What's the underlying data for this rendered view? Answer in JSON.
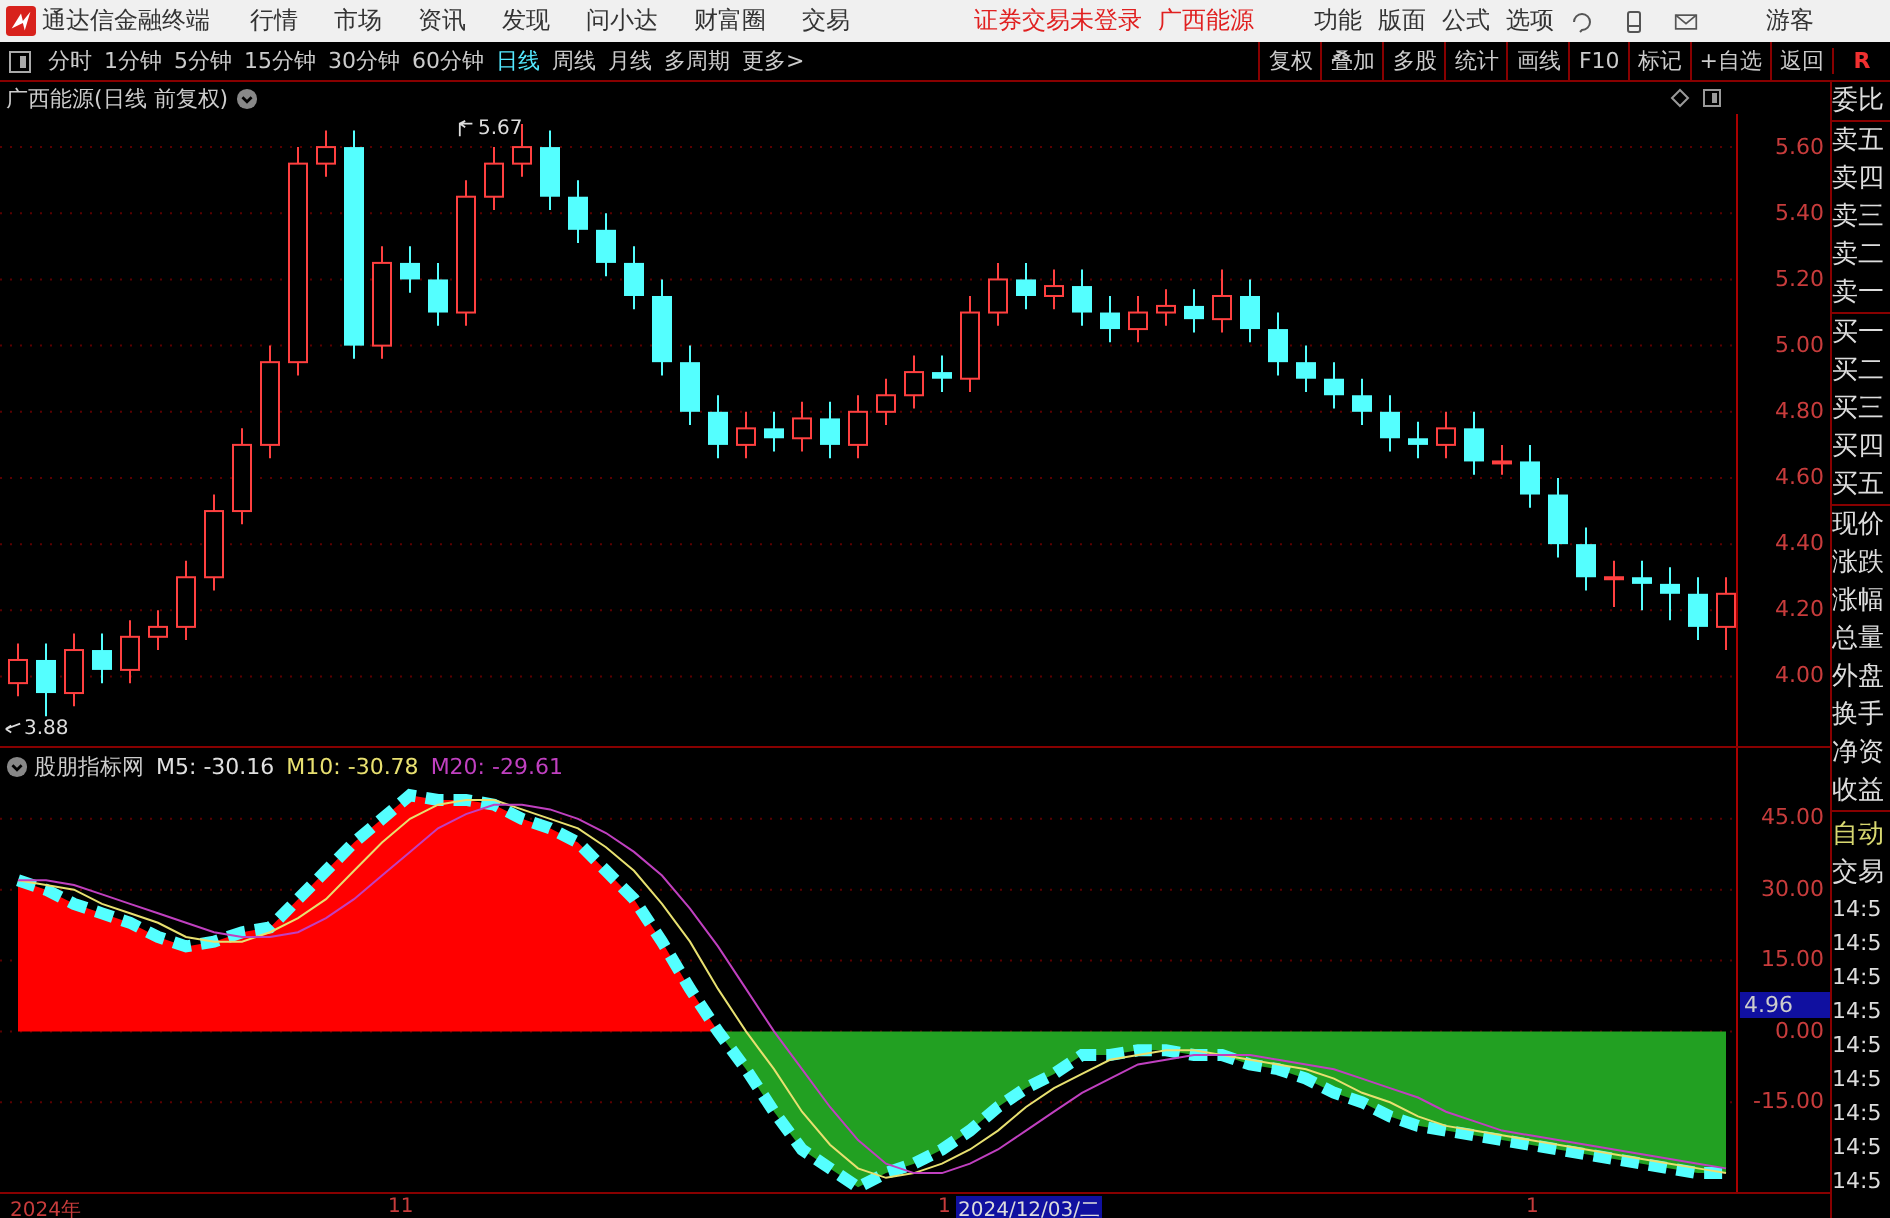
{
  "app_bar": {
    "app_name": "通达信金融终端",
    "menu": [
      "行情",
      "市场",
      "资讯",
      "发现",
      "问小达",
      "财富圈",
      "交易"
    ],
    "login_status": "证券交易未登录",
    "stock_name": "广西能源",
    "actions": [
      "功能",
      "版面",
      "公式",
      "选项"
    ],
    "user": "游客"
  },
  "period_tabs": [
    {
      "label": "分时",
      "selected": false
    },
    {
      "label": "1分钟",
      "selected": false
    },
    {
      "label": "5分钟",
      "selected": false
    },
    {
      "label": "15分钟",
      "selected": false
    },
    {
      "label": "30分钟",
      "selected": false
    },
    {
      "label": "60分钟",
      "selected": false
    },
    {
      "label": "日线",
      "selected": true
    },
    {
      "label": "周线",
      "selected": false
    },
    {
      "label": "月线",
      "selected": false
    },
    {
      "label": "多周期",
      "selected": false
    },
    {
      "label": "更多>",
      "selected": false
    }
  ],
  "chart_tools": [
    "复权",
    "叠加",
    "多股",
    "统计",
    "画线",
    "F10",
    "标记",
    "+自选",
    "返回"
  ],
  "right_column_header": "R",
  "price_chart": {
    "title": "广西能源(日线 前复权)",
    "high_marker": "5.67",
    "low_marker": "3.88",
    "chart_data": {
      "type": "candlestick",
      "grid": true,
      "ylim": [
        3.79,
        5.7
      ],
      "yticks": [
        {
          "value": 5.6,
          "label": "5.60"
        },
        {
          "value": 5.4,
          "label": "5.40"
        },
        {
          "value": 5.2,
          "label": "5.20"
        },
        {
          "value": 5.0,
          "label": "5.00"
        },
        {
          "value": 4.8,
          "label": "4.80"
        },
        {
          "value": 4.6,
          "label": "4.60"
        },
        {
          "value": 4.4,
          "label": "4.40"
        },
        {
          "value": 4.2,
          "label": "4.20"
        },
        {
          "value": 4.0,
          "label": "4.00"
        }
      ],
      "ohlc": [
        [
          3.98,
          4.1,
          3.94,
          4.05
        ],
        [
          4.05,
          4.1,
          3.88,
          3.95
        ],
        [
          3.95,
          4.13,
          3.91,
          4.08
        ],
        [
          4.08,
          4.13,
          3.98,
          4.02
        ],
        [
          4.02,
          4.17,
          3.98,
          4.12
        ],
        [
          4.12,
          4.2,
          4.08,
          4.15
        ],
        [
          4.15,
          4.35,
          4.11,
          4.3
        ],
        [
          4.3,
          4.55,
          4.26,
          4.5
        ],
        [
          4.5,
          4.75,
          4.46,
          4.7
        ],
        [
          4.7,
          5.0,
          4.66,
          4.95
        ],
        [
          4.95,
          5.6,
          4.91,
          5.55
        ],
        [
          5.55,
          5.65,
          5.51,
          5.6
        ],
        [
          5.6,
          5.65,
          4.96,
          5.0
        ],
        [
          5.0,
          5.3,
          4.96,
          5.25
        ],
        [
          5.25,
          5.3,
          5.16,
          5.2
        ],
        [
          5.2,
          5.25,
          5.06,
          5.1
        ],
        [
          5.1,
          5.5,
          5.06,
          5.45
        ],
        [
          5.45,
          5.6,
          5.41,
          5.55
        ],
        [
          5.55,
          5.67,
          5.51,
          5.6
        ],
        [
          5.6,
          5.65,
          5.41,
          5.45
        ],
        [
          5.45,
          5.5,
          5.31,
          5.35
        ],
        [
          5.35,
          5.4,
          5.21,
          5.25
        ],
        [
          5.25,
          5.3,
          5.11,
          5.15
        ],
        [
          5.15,
          5.2,
          4.91,
          4.95
        ],
        [
          4.95,
          5.0,
          4.76,
          4.8
        ],
        [
          4.8,
          4.85,
          4.66,
          4.7
        ],
        [
          4.7,
          4.8,
          4.66,
          4.75
        ],
        [
          4.75,
          4.8,
          4.68,
          4.72
        ],
        [
          4.72,
          4.83,
          4.68,
          4.78
        ],
        [
          4.78,
          4.83,
          4.66,
          4.7
        ],
        [
          4.7,
          4.85,
          4.66,
          4.8
        ],
        [
          4.8,
          4.9,
          4.76,
          4.85
        ],
        [
          4.85,
          4.97,
          4.81,
          4.92
        ],
        [
          4.92,
          4.97,
          4.86,
          4.9
        ],
        [
          4.9,
          5.15,
          4.86,
          5.1
        ],
        [
          5.1,
          5.25,
          5.06,
          5.2
        ],
        [
          5.2,
          5.25,
          5.11,
          5.15
        ],
        [
          5.15,
          5.23,
          5.11,
          5.18
        ],
        [
          5.18,
          5.23,
          5.06,
          5.1
        ],
        [
          5.1,
          5.15,
          5.01,
          5.05
        ],
        [
          5.05,
          5.15,
          5.01,
          5.1
        ],
        [
          5.1,
          5.17,
          5.06,
          5.12
        ],
        [
          5.12,
          5.17,
          5.04,
          5.08
        ],
        [
          5.08,
          5.23,
          5.04,
          5.15
        ],
        [
          5.15,
          5.2,
          5.01,
          5.05
        ],
        [
          5.05,
          5.1,
          4.91,
          4.95
        ],
        [
          4.95,
          5.0,
          4.86,
          4.9
        ],
        [
          4.9,
          4.95,
          4.81,
          4.85
        ],
        [
          4.85,
          4.9,
          4.76,
          4.8
        ],
        [
          4.8,
          4.85,
          4.68,
          4.72
        ],
        [
          4.72,
          4.77,
          4.66,
          4.7
        ],
        [
          4.7,
          4.8,
          4.66,
          4.75
        ],
        [
          4.75,
          4.8,
          4.61,
          4.65
        ],
        [
          4.65,
          4.7,
          4.61,
          4.65
        ],
        [
          4.65,
          4.7,
          4.51,
          4.55
        ],
        [
          4.55,
          4.6,
          4.36,
          4.4
        ],
        [
          4.4,
          4.45,
          4.26,
          4.3
        ],
        [
          4.3,
          4.35,
          4.21,
          4.3
        ],
        [
          4.3,
          4.35,
          4.2,
          4.28
        ],
        [
          4.28,
          4.33,
          4.17,
          4.25
        ],
        [
          4.25,
          4.3,
          4.11,
          4.15
        ],
        [
          4.15,
          4.3,
          4.08,
          4.25
        ]
      ]
    }
  },
  "indicator": {
    "name": "股朋指标网",
    "legend_values": [
      ": -30.16",
      ": -30.78",
      ": -29.61"
    ],
    "current_value": "4.96",
    "chart_data": {
      "type": "line",
      "grid": true,
      "ylim": [
        -34,
        60
      ],
      "yticks": [
        {
          "value": 45,
          "label": "45.00"
        },
        {
          "value": 30,
          "label": "30.00"
        },
        {
          "value": 15,
          "label": "15.00"
        },
        {
          "value": 0,
          "label": "0.00"
        },
        {
          "value": -15,
          "label": "-15.00"
        }
      ],
      "series": [
        {
          "name": "M5",
          "color": "#54ffff",
          "line_style": "dashed",
          "values": [
            32,
            30,
            27,
            25,
            23,
            20,
            18,
            19,
            21,
            22,
            28,
            34,
            40,
            45,
            50,
            49,
            49,
            48,
            45,
            43,
            40,
            34,
            28,
            19,
            9,
            0,
            -8,
            -17,
            -25,
            -29,
            -33,
            -30,
            -28,
            -25,
            -21,
            -16,
            -12,
            -9,
            -5,
            -5,
            -4,
            -4,
            -5,
            -5,
            -7,
            -8,
            -10,
            -13,
            -15,
            -18,
            -20,
            -21,
            -22,
            -23,
            -24,
            -25,
            -26,
            -27,
            -28,
            -29,
            -30,
            -30
          ]
        },
        {
          "name": "M10",
          "color": "#e8e070",
          "values": [
            32,
            31,
            30,
            27,
            25,
            23,
            20,
            19,
            19,
            21,
            24,
            28,
            34,
            40,
            45,
            48,
            49,
            49,
            47,
            45,
            43,
            39,
            34,
            27,
            19,
            9,
            0,
            -8,
            -17,
            -24,
            -29,
            -31,
            -30,
            -28,
            -25,
            -21,
            -16,
            -12,
            -9,
            -6,
            -5,
            -4,
            -4,
            -5,
            -6,
            -7,
            -8,
            -10,
            -13,
            -15,
            -18,
            -20,
            -21,
            -22,
            -23,
            -24,
            -25,
            -26,
            -27,
            -28,
            -29,
            -30
          ]
        },
        {
          "name": "M20",
          "color": "#c040c0",
          "values": [
            32,
            32,
            31,
            29,
            27,
            25,
            23,
            21,
            20,
            20,
            21,
            24,
            28,
            33,
            38,
            43,
            46,
            48,
            48,
            47,
            45,
            42,
            38,
            33,
            26,
            18,
            9,
            0,
            -8,
            -16,
            -23,
            -28,
            -30,
            -30,
            -28,
            -25,
            -21,
            -17,
            -13,
            -10,
            -7,
            -6,
            -5,
            -5,
            -5,
            -6,
            -7,
            -8,
            -10,
            -12,
            -14,
            -17,
            -19,
            -21,
            -22,
            -23,
            -24,
            -25,
            -26,
            -27,
            -28,
            -29
          ]
        }
      ]
    }
  },
  "date_axis": [
    {
      "label": "2024年",
      "selected": false
    },
    {
      "label": "11",
      "selected": false
    },
    {
      "label": "1",
      "selected": false
    },
    {
      "label": "2024/12/03/二",
      "selected": true
    },
    {
      "label": "1",
      "selected": false
    }
  ],
  "quote_panel": {
    "groups": [
      [
        "委比"
      ],
      [
        "卖五",
        "卖四",
        "卖三",
        "卖二",
        "卖一"
      ],
      [
        "买一",
        "买二",
        "买三",
        "买四",
        "买五"
      ],
      [
        "现价",
        "涨跌",
        "涨幅",
        "总量",
        "外盘",
        "换手",
        "净资",
        "收益"
      ]
    ],
    "mode": "自动",
    "trade": "交易",
    "times": [
      "14:5",
      "14:5",
      "14:5",
      "14:5",
      "14:5",
      "14:5",
      "14:5",
      "14:5",
      "14:5"
    ]
  }
}
